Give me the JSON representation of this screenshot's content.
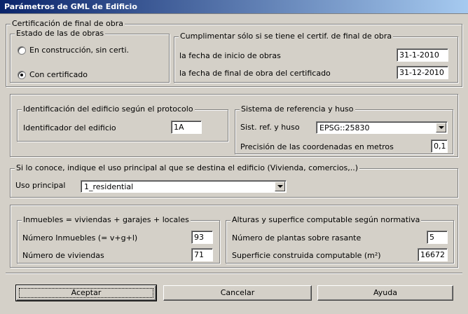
{
  "window": {
    "title": "Parámetros de GML de Edificio"
  },
  "certificacion": {
    "legend": "Certificación de final de obra",
    "estado": {
      "legend": "Estado de las de obras",
      "options": [
        {
          "label": "En construcción, sin certi.",
          "selected": false
        },
        {
          "label": "Con certificado",
          "selected": true
        }
      ]
    },
    "fechas": {
      "legend": "Cumplimentar sólo si se tiene el certif. de final de obra",
      "inicio_label": "la fecha de inicio de obras",
      "inicio_value": "31-1-2010",
      "final_label": "la fecha de final de obra del certificado",
      "final_value": "31-12-2010"
    }
  },
  "identificacion": {
    "legend": "Identificación del edificio según el protocolo",
    "id_label": "Identificador del edificio",
    "id_value": "1A"
  },
  "sistema": {
    "legend": "Sistema de referencia y huso",
    "srs_label": "Sist. ref. y huso",
    "srs_value": "EPSG::25830",
    "precision_label": "Precisión de las coordenadas en metros",
    "precision_value": "0,1"
  },
  "uso": {
    "legend": "Si lo conoce, indique el uso principal al que se destina el edificio (Vivienda, comercios,..)",
    "label": "Uso principal",
    "value": "1_residential"
  },
  "inmuebles": {
    "legend": "Inmuebles = viviendas + garajes + locales",
    "num_inmuebles_label": "Número Inmuebles (= v+g+l)",
    "num_inmuebles_value": "93",
    "num_viviendas_label": "Número de viviendas",
    "num_viviendas_value": "71"
  },
  "alturas": {
    "legend": "Alturas y superfice computable según normativa",
    "plantas_label": "Número de plantas sobre rasante",
    "plantas_value": "5",
    "superficie_label": "Superficie construida computable (m²)",
    "superficie_value": "16672"
  },
  "buttons": {
    "aceptar": "Aceptar",
    "cancelar": "Cancelar",
    "ayuda": "Ayuda"
  }
}
